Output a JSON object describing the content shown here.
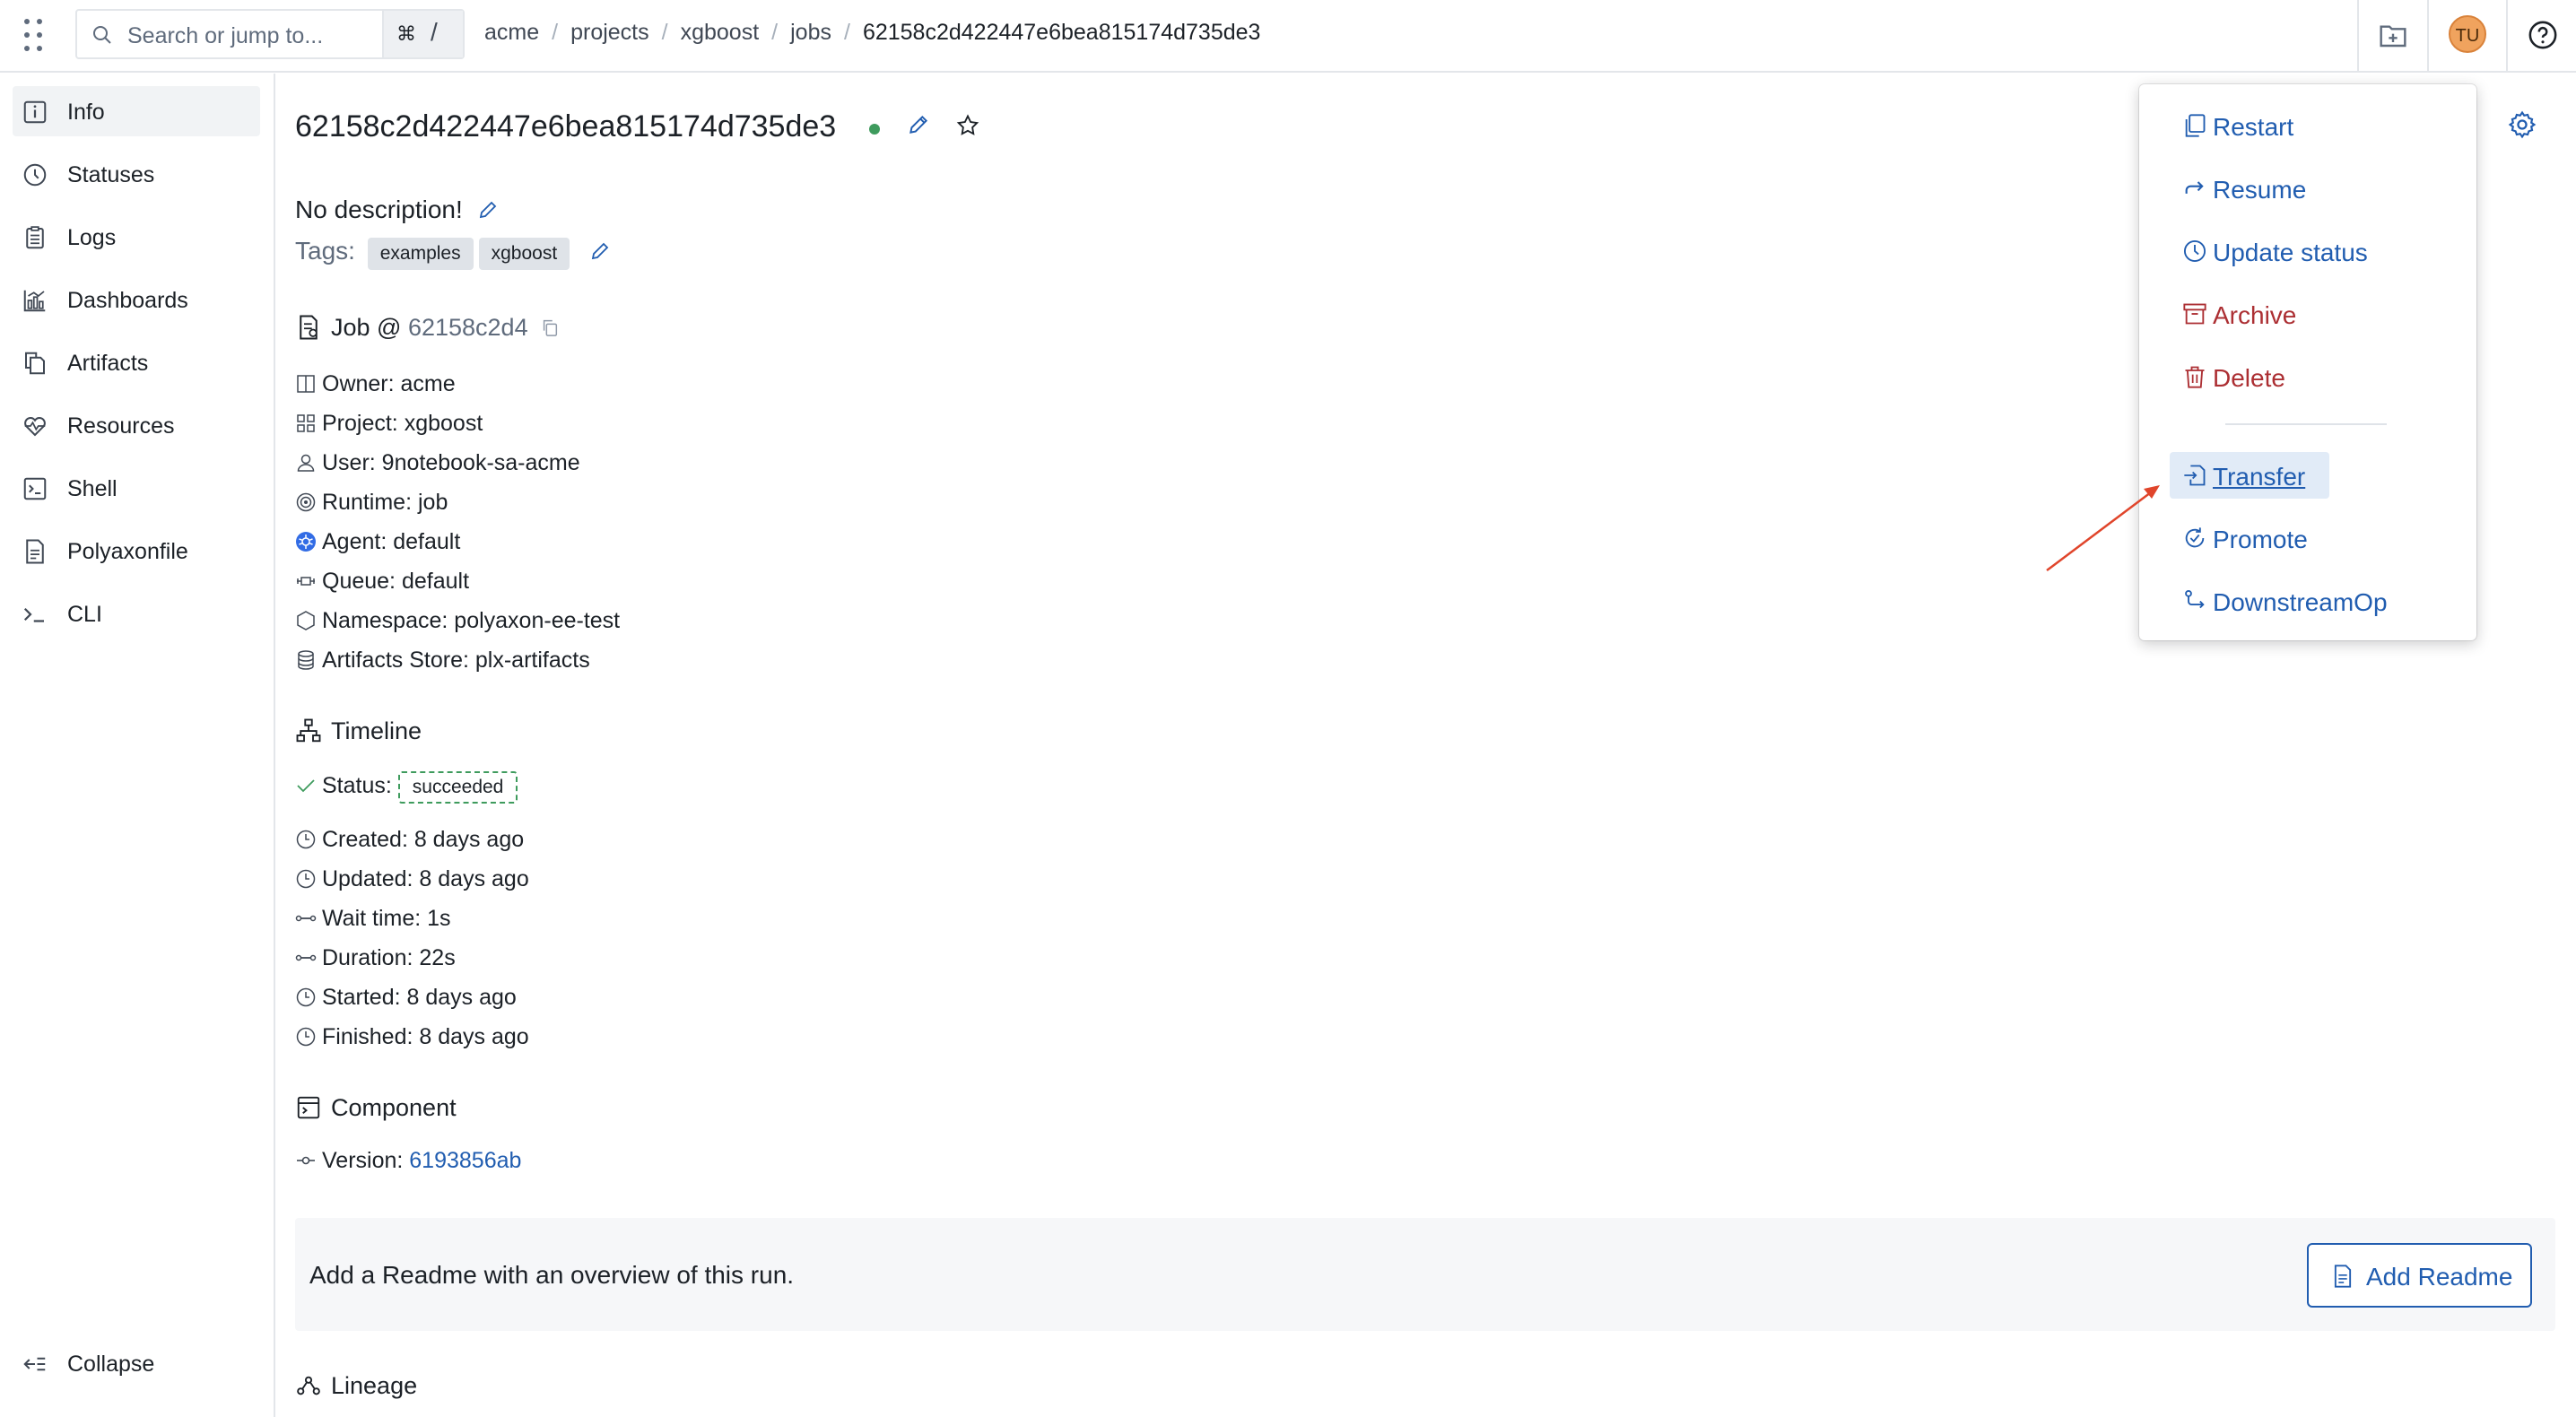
{
  "topbar": {
    "search_placeholder": "Search or jump to...",
    "shortcut_cmd": "⌘",
    "shortcut_slash": "/",
    "breadcrumbs": [
      "acme",
      "projects",
      "xgboost",
      "jobs",
      "62158c2d422447e6bea815174d735de3"
    ],
    "avatar_initials": "TU"
  },
  "sidebar": {
    "items": [
      {
        "label": "Info",
        "icon": "info-icon",
        "active": true
      },
      {
        "label": "Statuses",
        "icon": "history-icon"
      },
      {
        "label": "Logs",
        "icon": "clipboard-icon"
      },
      {
        "label": "Dashboards",
        "icon": "chart-icon"
      },
      {
        "label": "Artifacts",
        "icon": "documents-icon"
      },
      {
        "label": "Resources",
        "icon": "heart-pulse-icon"
      },
      {
        "label": "Shell",
        "icon": "console-icon"
      },
      {
        "label": "Polyaxonfile",
        "icon": "document-icon"
      },
      {
        "label": "CLI",
        "icon": "prompt-icon"
      }
    ],
    "collapse_label": "Collapse"
  },
  "run": {
    "uuid": "62158c2d422447e6bea815174d735de3",
    "description": "No description!",
    "tags_label": "Tags:",
    "tags": [
      "examples",
      "xgboost"
    ]
  },
  "job": {
    "title_prefix": "Job @ ",
    "short_uuid": "62158c2d4",
    "owner": "Owner: acme",
    "project": "Project: xgboost",
    "user": "User: 9notebook-sa-acme",
    "runtime": "Runtime: job",
    "agent": "Agent: default",
    "queue": "Queue: default",
    "namespace": "Namespace: polyaxon-ee-test",
    "artifacts_store": "Artifacts Store: plx-artifacts"
  },
  "timeline": {
    "title": "Timeline",
    "status_label": "Status:",
    "status_value": "succeeded",
    "created": "Created: 8 days ago",
    "updated": "Updated: 8 days ago",
    "wait_time": "Wait time: 1s",
    "duration": "Duration: 22s",
    "started": "Started: 8 days ago",
    "finished": "Finished: 8 days ago"
  },
  "component": {
    "title": "Component",
    "version_label": "Version: ",
    "version": "6193856ab"
  },
  "readme": {
    "text": "Add a Readme with an overview of this run.",
    "button": "Add Readme"
  },
  "lineage": {
    "title": "Lineage"
  },
  "menu": {
    "items": [
      {
        "label": "Restart",
        "kind": "blue",
        "icon": "duplicate-icon"
      },
      {
        "label": "Resume",
        "kind": "blue",
        "icon": "redo-icon"
      },
      {
        "label": "Update status",
        "kind": "blue",
        "icon": "history-icon"
      },
      {
        "label": "Archive",
        "kind": "red",
        "icon": "archive-icon"
      },
      {
        "label": "Delete",
        "kind": "red",
        "icon": "trash-icon"
      },
      {
        "label": "Transfer",
        "kind": "blue",
        "icon": "import-icon",
        "hovered": true
      },
      {
        "label": "Promote",
        "kind": "blue",
        "icon": "refresh-icon"
      },
      {
        "label": "DownstreamOp",
        "kind": "blue",
        "icon": "flow-linear-icon"
      }
    ]
  },
  "colors": {
    "accent": "#215db0",
    "danger": "#ac2f33",
    "success": "#3e9b5d",
    "annotation_arrow": "#e0452b"
  }
}
